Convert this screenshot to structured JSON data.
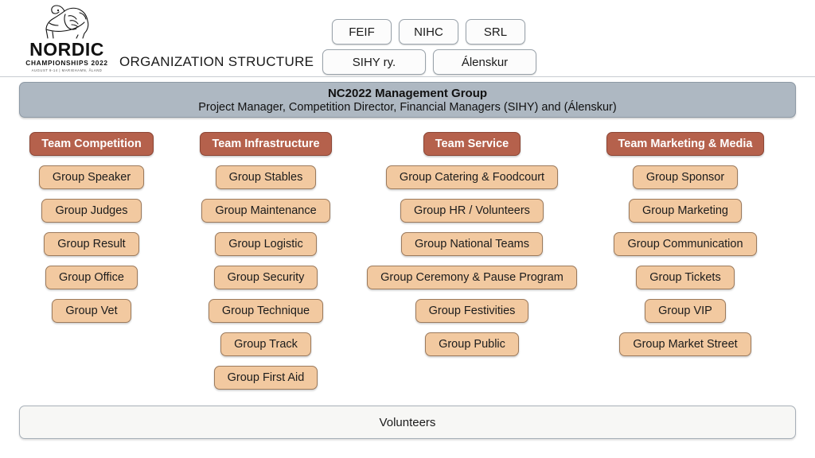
{
  "header": {
    "title": "ORGANIZATION STRUCTURE",
    "logo": {
      "mark": "nordic-horse-emblem",
      "name": "NORDIC",
      "subtitle": "CHAMPIONSHIPS 2022",
      "date_line": "AUGUST 9-14  |  MARIEHAMN, ÅLAND"
    },
    "affiliations_row1": [
      "FEIF",
      "NIHC",
      "SRL"
    ],
    "affiliations_row2": [
      "SIHY ry.",
      "Álenskur"
    ]
  },
  "management": {
    "title": "NC2022 Management Group",
    "members": "Project Manager, Competition Director, Financial Managers (SIHY) and (Álenskur)"
  },
  "teams": [
    {
      "name": "Team Competition",
      "groups": [
        "Group Speaker",
        "Group Judges",
        "Group Result",
        "Group Office",
        "Group Vet"
      ]
    },
    {
      "name": "Team Infrastructure",
      "groups": [
        "Group Stables",
        "Group Maintenance",
        "Group Logistic",
        "Group Security",
        "Group Technique",
        "Group Track",
        "Group First Aid"
      ]
    },
    {
      "name": "Team Service",
      "groups": [
        "Group Catering & Foodcourt",
        "Group HR / Volunteers",
        "Group National Teams",
        "Group Ceremony & Pause Program",
        "Group Festivities",
        "Group Public"
      ]
    },
    {
      "name": "Team Marketing & Media",
      "groups": [
        "Group Sponsor",
        "Group Marketing",
        "Group Communication",
        "Group Tickets",
        "Group VIP",
        "Group Market Street"
      ]
    }
  ],
  "footer": {
    "volunteers": "Volunteers"
  },
  "colors": {
    "team_header": "#b5614c",
    "group_box": "#f2c9a0",
    "management_banner": "#aeb8c2",
    "volunteers_bar": "#f7f7f5"
  }
}
